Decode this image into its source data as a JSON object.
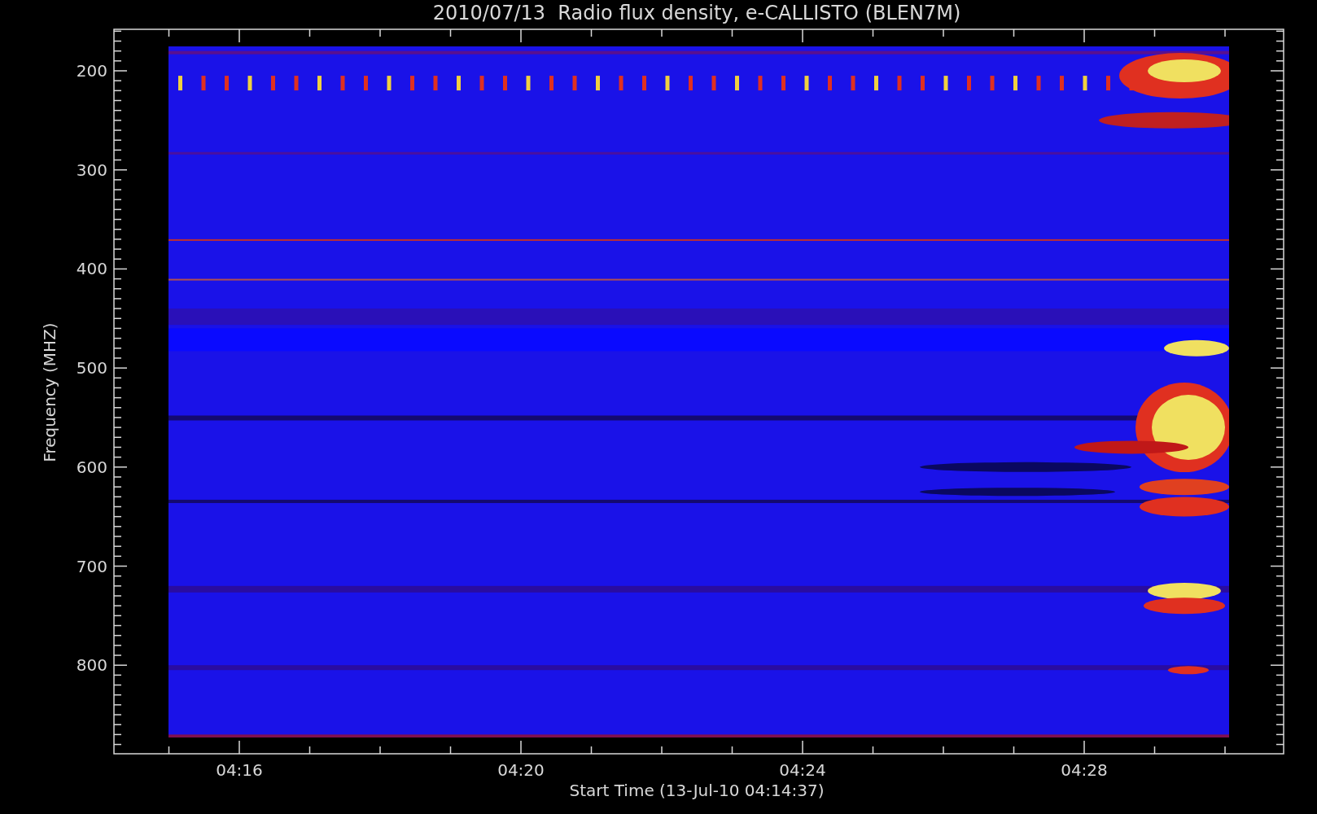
{
  "title": "2010/07/13  Radio flux density, e-CALLISTO (BLEN7M)",
  "y_axis": {
    "label": "Frequency (MHZ)",
    "ticks": [
      "200",
      "300",
      "400",
      "500",
      "600",
      "700",
      "800"
    ]
  },
  "x_axis": {
    "label": "Start Time (13-Jul-10 04:14:37)",
    "ticks": [
      "04:16",
      "04:20",
      "04:24",
      "04:28"
    ]
  }
}
